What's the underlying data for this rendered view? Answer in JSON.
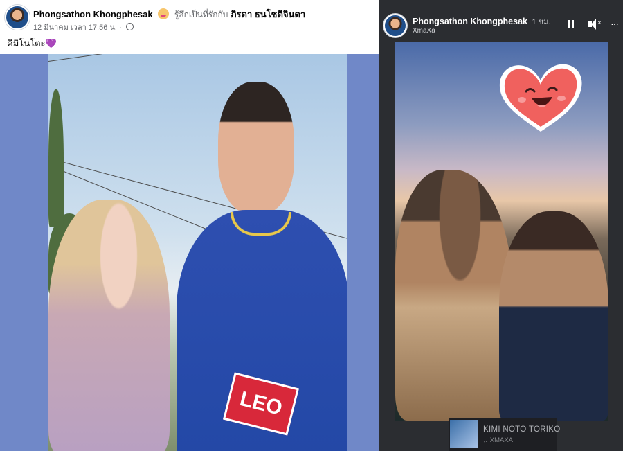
{
  "post": {
    "author": "Phongsathon Khongphesak",
    "feeling_text": "รู้สึกเป็นที่รักกับ",
    "tagged_person": "ภิรดา ธนโชติจินดา",
    "timestamp": "12 มีนาคม เวลา 17:56 น.",
    "privacy_separator": "·",
    "caption": "คิมิโนโตะ",
    "caption_emoji": "💜",
    "photo_text": "LEO"
  },
  "story": {
    "author": "Phongsathon Khongphesak",
    "time_ago": "1 ชม.",
    "music_label": "XmaXa",
    "more_label": "···",
    "mute_mark": "×",
    "progress": 0.12,
    "track_title": "KIMI NOTO TORIKO",
    "track_artist": "♫ XMAXA"
  },
  "colors": {
    "post_photo_border": "#7088c8",
    "story_background": "#2b2d31",
    "heart_sticker": "#f0615e",
    "feeling_emoji": "#f7c56b"
  },
  "icons": [
    "globe-icon",
    "pause-icon",
    "mute-icon",
    "more-icon",
    "heart-sticker-icon",
    "music-note-icon"
  ]
}
